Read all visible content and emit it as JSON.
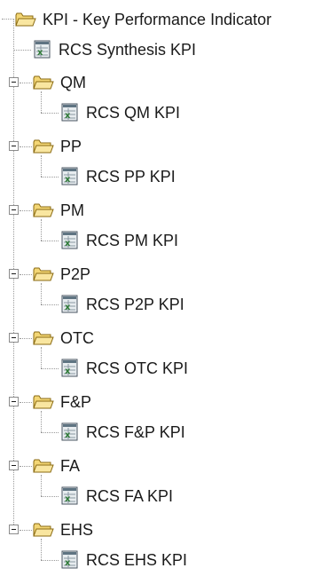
{
  "tree": {
    "root": {
      "label": "KPI - Key  Performance Indicator",
      "icon": "folder-open-icon"
    },
    "root_item": {
      "label": "RCS Synthesis KPI",
      "icon": "kpi-document-icon"
    },
    "groups": [
      {
        "label": "QM",
        "expanded": true,
        "child_label": "RCS QM KPI"
      },
      {
        "label": "PP",
        "expanded": true,
        "child_label": "RCS PP KPI"
      },
      {
        "label": "PM",
        "expanded": true,
        "child_label": "RCS PM KPI"
      },
      {
        "label": "P2P",
        "expanded": true,
        "child_label": "RCS P2P KPI"
      },
      {
        "label": "OTC",
        "expanded": true,
        "child_label": "RCS OTC KPI"
      },
      {
        "label": "F&P",
        "expanded": true,
        "child_label": "RCS F&P KPI"
      },
      {
        "label": "FA",
        "expanded": true,
        "child_label": "RCS FA KPI"
      },
      {
        "label": "EHS",
        "expanded": true,
        "child_label": "RCS EHS KPI"
      }
    ]
  },
  "colors": {
    "folder_fill": "#f3d675",
    "folder_stroke": "#8a6a12",
    "kpi_icon_accent": "#2d7a35"
  }
}
